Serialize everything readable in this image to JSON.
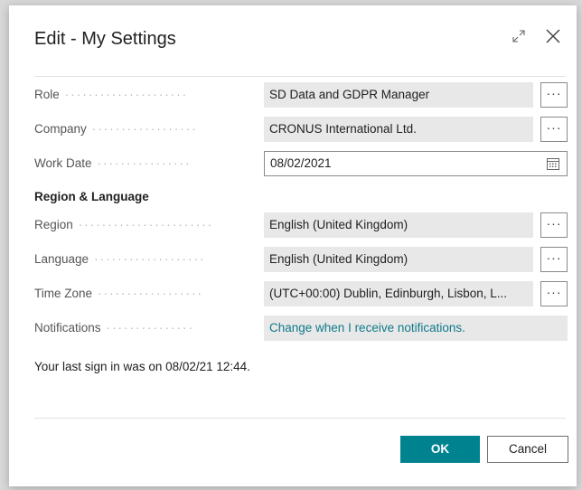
{
  "dialog": {
    "title": "Edit - My Settings",
    "fields": [
      {
        "label": "Role",
        "value": "SD Data and GDPR Manager"
      },
      {
        "label": "Company",
        "value": "CRONUS International Ltd."
      },
      {
        "label": "Work Date",
        "value": "08/02/2021"
      }
    ],
    "region_section": {
      "heading": "Region & Language",
      "fields": [
        {
          "label": "Region",
          "value": "English (United Kingdom)"
        },
        {
          "label": "Language",
          "value": "English (United Kingdom)"
        },
        {
          "label": "Time Zone",
          "value": "(UTC+00:00) Dublin, Edinburgh, Lisbon, L..."
        },
        {
          "label": "Notifications",
          "value": "Change when I receive notifications."
        }
      ]
    },
    "last_sign_in": "Your last sign in was on 08/02/21 12:44.",
    "assist_label": "···",
    "ok_label": "OK",
    "cancel_label": "Cancel",
    "colors": {
      "accent": "#00838f",
      "link": "#0f7a8a",
      "readonly_field": "#e8e8e8"
    }
  }
}
